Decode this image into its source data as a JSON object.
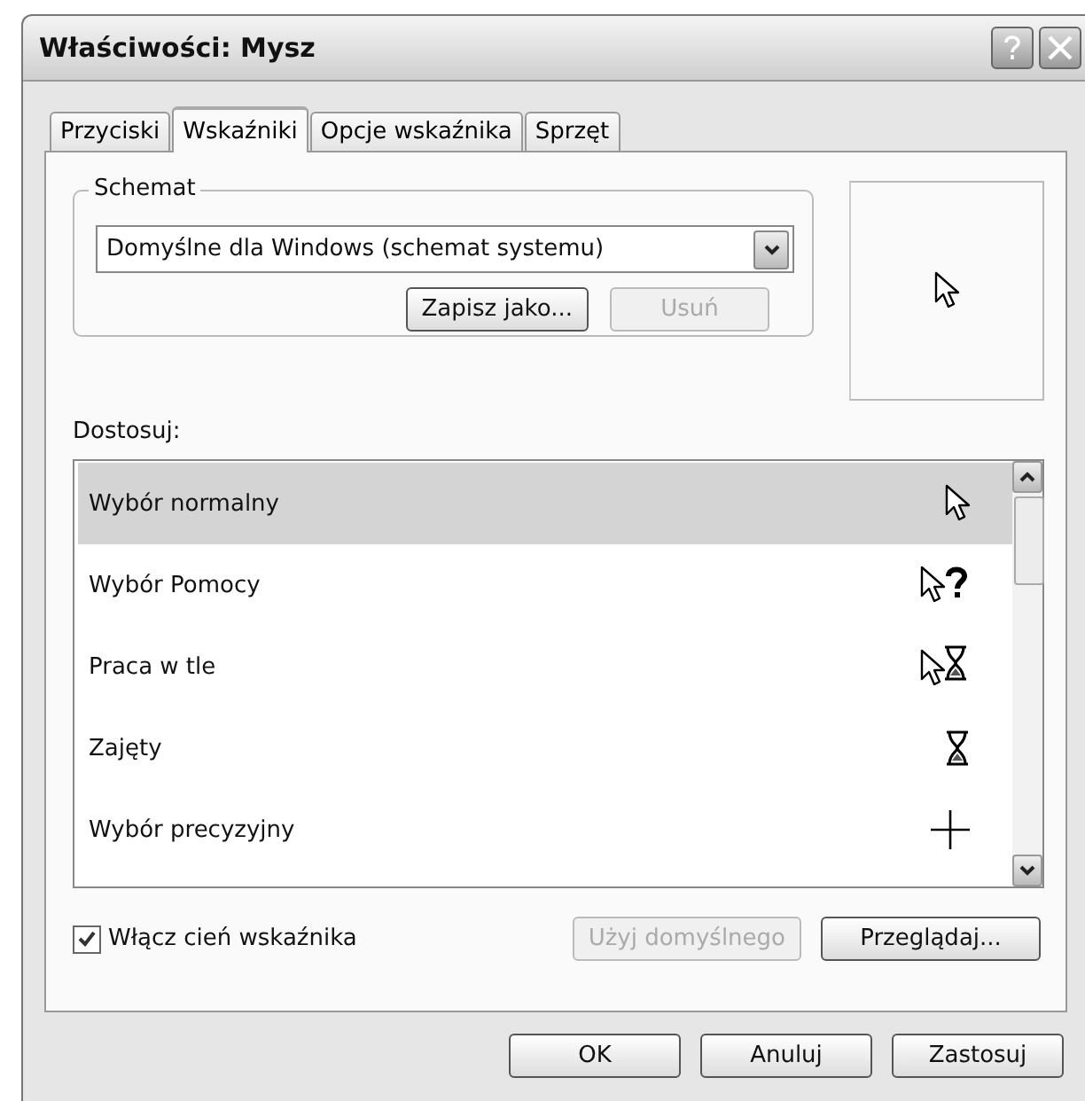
{
  "window": {
    "title": "Właściwości: Mysz"
  },
  "tabs": [
    {
      "label": "Przyciski",
      "selected": false
    },
    {
      "label": "Wskaźniki",
      "selected": true
    },
    {
      "label": "Opcje wskaźnika",
      "selected": false
    },
    {
      "label": "Sprzęt",
      "selected": false
    }
  ],
  "scheme": {
    "label": "Schemat",
    "value": "Domyślne dla Windows (schemat systemu)",
    "buttons": [
      {
        "label": "Zapisz jako...",
        "disabled": false
      },
      {
        "label": "Usuń",
        "disabled": true
      }
    ]
  },
  "customize": {
    "label": "Dostosuj:",
    "items": [
      {
        "name": "Wybór normalny",
        "kind": "arrow",
        "selected": true
      },
      {
        "name": "Wybór Pomocy",
        "kind": "help",
        "selected": false
      },
      {
        "name": "Praca w tle",
        "kind": "working",
        "selected": false
      },
      {
        "name": "Zajęty",
        "kind": "busy",
        "selected": false
      },
      {
        "name": "Wybór precyzyjny",
        "kind": "cross",
        "selected": false
      }
    ]
  },
  "shadow": {
    "label": "Włącz cień wskaźnika",
    "checked": true
  },
  "list_buttons": [
    {
      "label": "Użyj domyślnego",
      "disabled": true
    },
    {
      "label": "Przeglądaj...",
      "disabled": false
    }
  ],
  "dialog_buttons": [
    {
      "label": "OK",
      "disabled": false
    },
    {
      "label": "Anuluj",
      "disabled": false
    },
    {
      "label": "Zastosuj",
      "disabled": false
    }
  ]
}
